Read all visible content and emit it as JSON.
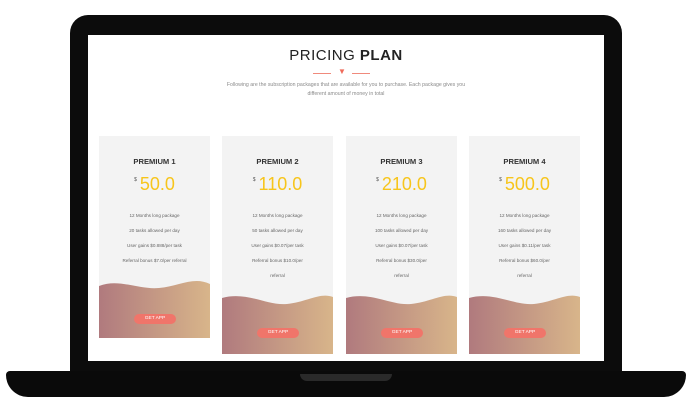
{
  "header": {
    "title_light": "PRICING ",
    "title_bold": "PLAN",
    "subtitle_line1": "Following are the subscription packages that are available for you to purchase. Each package gives you",
    "subtitle_line2": "different amount of money in total"
  },
  "colors": {
    "accent": "#f7c51b",
    "button": "#f0756a",
    "wave_start": "#b07a7e",
    "wave_end": "#d8b58a"
  },
  "plans": [
    {
      "name": "PREMIUM 1",
      "currency": "$",
      "price": "50.0",
      "features": [
        "12 Months long package",
        "20 tasks allowed per day",
        "User gains $0.888/per task",
        "Referral bonus $7.0/per referral"
      ],
      "button": "GET APP"
    },
    {
      "name": "PREMIUM 2",
      "currency": "$",
      "price": "110.0",
      "features": [
        "12 Months long package",
        "50 tasks allowed per day",
        "User gains $0.07/per task",
        "Referral bonus $10.0/per",
        "referral"
      ],
      "button": "GET APP"
    },
    {
      "name": "PREMIUM 3",
      "currency": "$",
      "price": "210.0",
      "features": [
        "12 Months long package",
        "100 tasks allowed per day",
        "User gains $0.07/per task",
        "Referral bonus $30.0/per",
        "referral"
      ],
      "button": "GET APP"
    },
    {
      "name": "PREMIUM 4",
      "currency": "$",
      "price": "500.0",
      "features": [
        "12 Months long package",
        "160 tasks allowed per day",
        "User gains $0.11/per task",
        "Referral bonus $60.0/per",
        "referral"
      ],
      "button": "GET APP"
    }
  ]
}
